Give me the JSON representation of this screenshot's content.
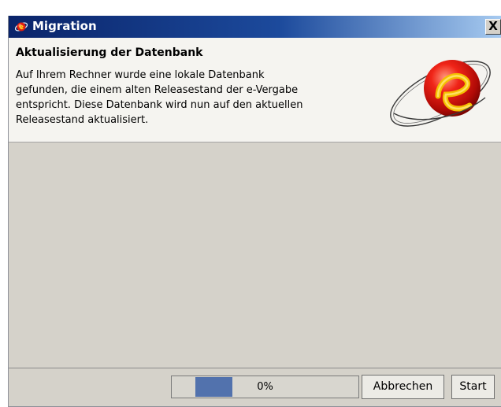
{
  "window": {
    "title": "Migration",
    "close_label": "X"
  },
  "header": {
    "title": "Aktualisierung der Datenbank",
    "description_lines": [
      "Auf Ihrem Rechner wurde eine lokale Datenbank",
      "gefunden, die einem alten Releasestand der e-Vergabe",
      "entspricht. Diese Datenbank wird nun auf den aktuellen",
      "Releasestand aktualisiert."
    ],
    "logo_icon": "e-vergabe-logo"
  },
  "progress": {
    "label": "0%",
    "percent": 0
  },
  "buttons": {
    "cancel_label": "Abbrechen",
    "start_label": "Start"
  },
  "colors": {
    "titlebar_dark": "#0a246a",
    "titlebar_light": "#a6caf0",
    "progress_fill": "#5272ad",
    "header_bg": "#f5f4f0",
    "content_bg": "#d5d2ca"
  }
}
